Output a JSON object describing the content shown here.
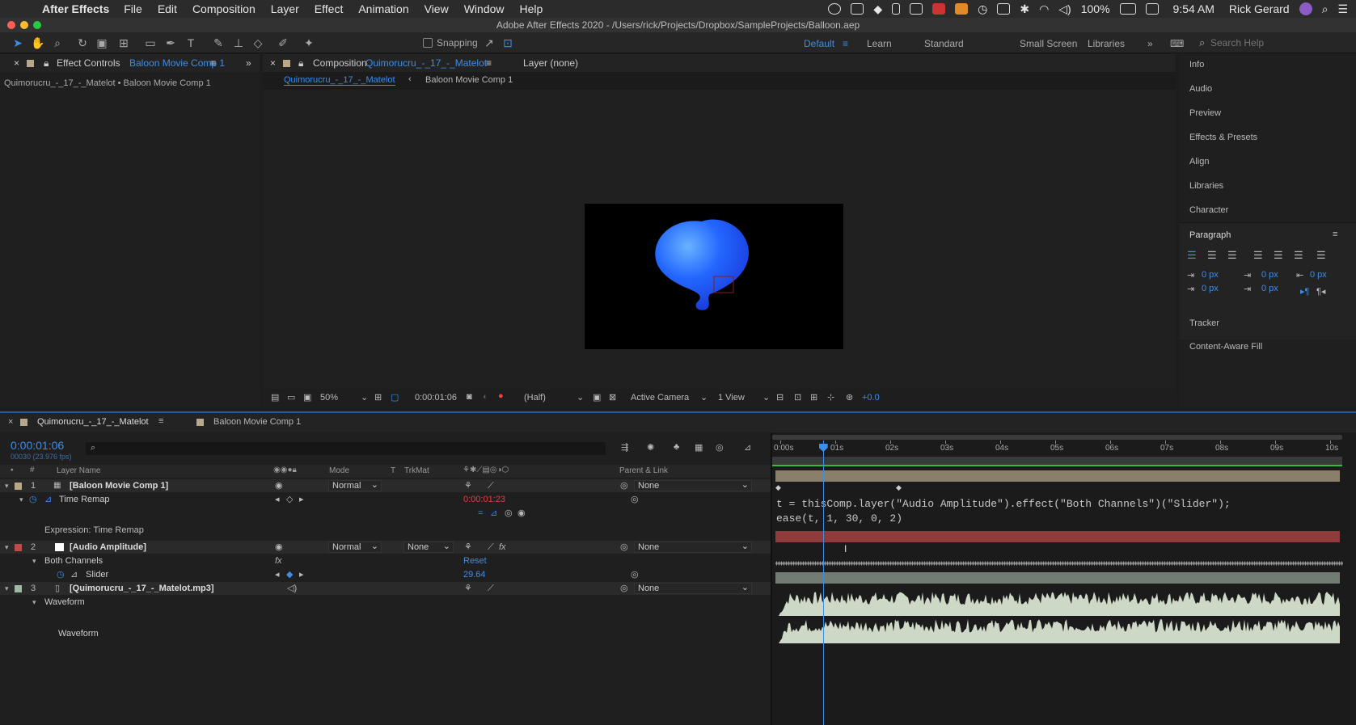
{
  "menubar": {
    "app": "After Effects",
    "items": [
      "File",
      "Edit",
      "Composition",
      "Layer",
      "Effect",
      "Animation",
      "View",
      "Window",
      "Help"
    ],
    "battery": "100%",
    "time": "9:54 AM",
    "user": "Rick Gerard"
  },
  "title": "Adobe After Effects 2020 - /Users/rick/Projects/Dropbox/SampleProjects/Balloon.aep",
  "toolbar": {
    "snapping": "Snapping",
    "workspaces": [
      "Default",
      "Learn",
      "Standard",
      "Small Screen",
      "Libraries"
    ],
    "search_placeholder": "Search Help"
  },
  "effect_controls": {
    "tab_label": "Effect Controls",
    "tab_target": "Baloon Movie Comp 1",
    "breadcrumb": "Quimorucru_-_17_-_Matelot • Baloon Movie Comp 1"
  },
  "composition": {
    "tab_label": "Composition",
    "tab_target": "Quimorucru_-_17_-_Matelot",
    "layer_tab": "Layer (none)",
    "flow": [
      "Quimorucru_-_17_-_Matelot",
      "Baloon Movie Comp 1"
    ],
    "zoom": "50%",
    "timecode": "0:00:01:06",
    "resolution": "(Half)",
    "camera": "Active Camera",
    "view": "1 View",
    "exposure": "+0.0"
  },
  "right_panels": {
    "items_top": [
      "Info",
      "Audio",
      "Preview",
      "Effects & Presets",
      "Align",
      "Libraries",
      "Character"
    ],
    "paragraph": {
      "title": "Paragraph",
      "indents": [
        "0 px",
        "0 px",
        "0 px",
        "0 px",
        "0 px"
      ]
    },
    "items_bottom": [
      "Tracker",
      "Content-Aware Fill"
    ]
  },
  "timeline": {
    "tabs": [
      "Quimorucru_-_17_-_Matelot",
      "Baloon Movie Comp 1"
    ],
    "current_time": "0:00:01:06",
    "frame_info": "00030 (23.976 fps)",
    "headers": {
      "layer_name": "Layer Name",
      "mode": "Mode",
      "t": "T",
      "trkmat": "TrkMat",
      "parent": "Parent & Link"
    },
    "ruler": [
      "0:00s",
      "01s",
      "02s",
      "03s",
      "04s",
      "05s",
      "06s",
      "07s",
      "08s",
      "09s",
      "10s"
    ],
    "layers": [
      {
        "num": "1",
        "name": "[Baloon Movie Comp 1]",
        "mode": "Normal",
        "parent": "None",
        "color": "#b9a78a"
      },
      {
        "num": "2",
        "name": "[Audio Amplitude]",
        "mode": "Normal",
        "trkmat": "None",
        "parent": "None",
        "color": "#c04a4a"
      },
      {
        "num": "3",
        "name": "[Quimorucru_-_17_-_Matelot.mp3]",
        "parent": "None",
        "color": "#9fb7a4"
      }
    ],
    "time_remap": {
      "label": "Time Remap",
      "value": "0:00:01:23"
    },
    "expression_label": "Expression: Time Remap",
    "expression": [
      "t = thisComp.layer(\"Audio Amplitude\").effect(\"Both Channels\")(\"Slider\");",
      "ease(t, 1, 30, 0, 2)"
    ],
    "both_channels": {
      "label": "Both Channels",
      "reset": "Reset"
    },
    "slider": {
      "label": "Slider",
      "value": "29.64"
    },
    "waveform_group": "Waveform",
    "waveform_label": "Waveform",
    "playhead_seconds": 1.25,
    "duration_seconds": 10
  }
}
